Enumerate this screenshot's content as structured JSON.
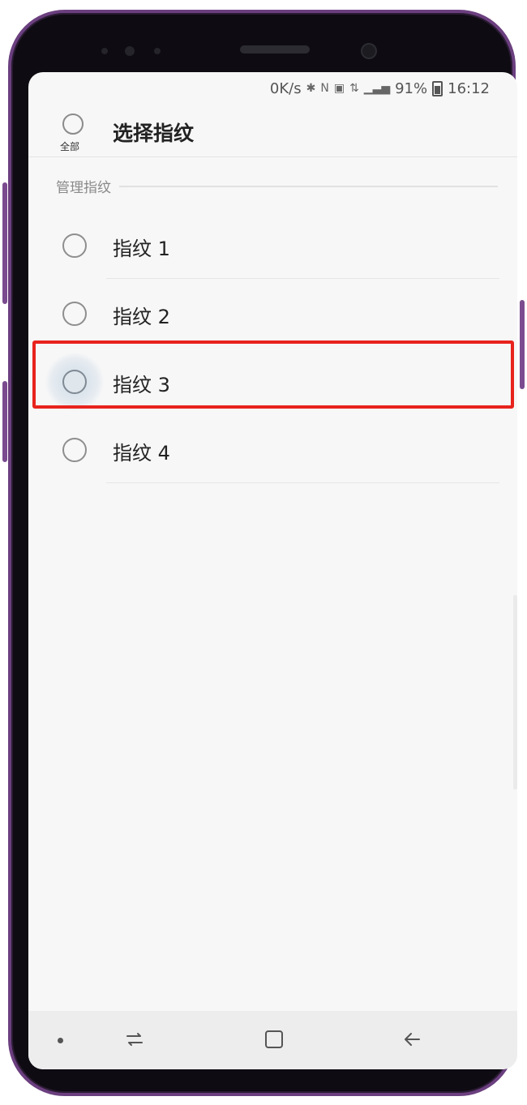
{
  "status_bar": {
    "network_speed": "0K/s",
    "battery_percent": "91%",
    "time": "16:12",
    "icons": [
      "bluetooth-icon",
      "nfc-icon",
      "vibrate-icon",
      "4g-icon",
      "signal-icon",
      "battery-icon"
    ]
  },
  "header": {
    "select_all_label": "全部",
    "title": "选择指纹"
  },
  "section": {
    "label": "管理指纹"
  },
  "fingerprints": [
    {
      "label": "指纹 1"
    },
    {
      "label": "指纹 2"
    },
    {
      "label": "指纹 3",
      "pressed": true,
      "highlighted": true
    },
    {
      "label": "指纹 4"
    }
  ],
  "nav_bar": {
    "buttons": [
      "dot-indicator",
      "recent-apps-icon",
      "home-icon",
      "back-icon"
    ]
  },
  "colors": {
    "highlight_box": "#e8231d",
    "phone_frame": "#6b3f7f",
    "screen_bg": "#f7f7f7"
  }
}
